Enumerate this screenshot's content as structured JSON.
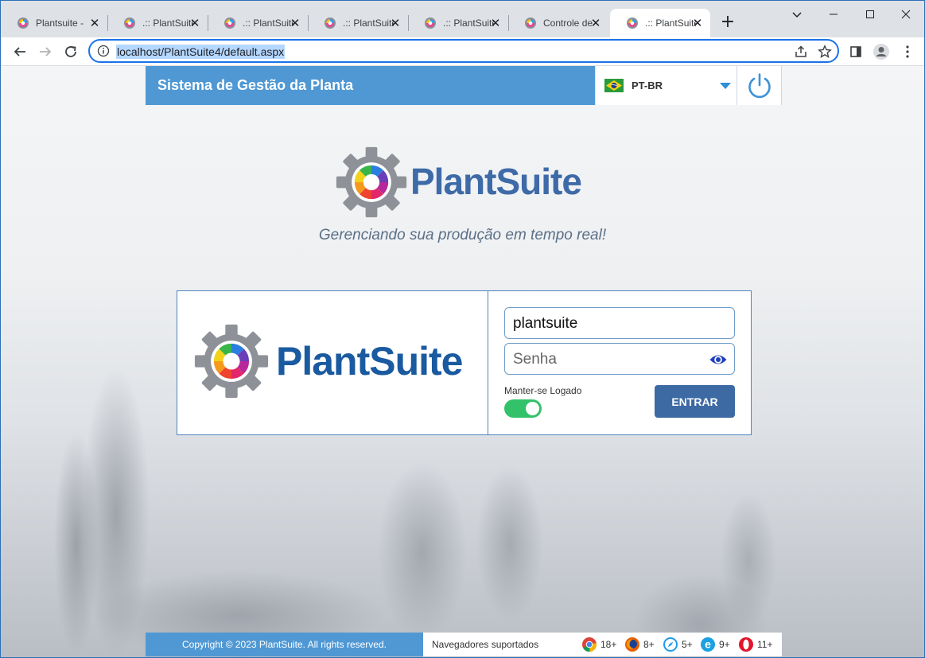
{
  "browser": {
    "tabs": [
      {
        "title": "Plantsuite - "
      },
      {
        "title": ".:: PlantSuite"
      },
      {
        "title": ".:: PlantSuite"
      },
      {
        "title": ".:: PlantSuite"
      },
      {
        "title": ".:: PlantSuite"
      },
      {
        "title": "Controle de "
      },
      {
        "title": ".:: PlantSuite"
      }
    ],
    "active_tab_index": 6,
    "url": "localhost/PlantSuite4/default.aspx"
  },
  "header": {
    "title": "Sistema de Gestão da Planta",
    "language": "PT-BR"
  },
  "hero": {
    "brand": "PlantSuite",
    "tagline": "Gerenciando sua produção em tempo real!"
  },
  "login": {
    "brand": "PlantSuite",
    "username_value": "plantsuite",
    "password_placeholder": "Senha",
    "keep_logged_label": "Manter-se Logado",
    "keep_logged_on": true,
    "submit_label": "ENTRAR"
  },
  "footer": {
    "copyright": "Copyright © 2023 PlantSuite. All rights reserved.",
    "browsers_label": "Navegadores suportados",
    "browsers": [
      {
        "name": "chrome-icon",
        "version": "18+"
      },
      {
        "name": "firefox-icon",
        "version": "8+"
      },
      {
        "name": "safari-icon",
        "version": "5+"
      },
      {
        "name": "ie-icon",
        "version": "9+"
      },
      {
        "name": "opera-icon",
        "version": "11+"
      }
    ]
  },
  "colors": {
    "header_blue": "#4f98d4",
    "brand_blue": "#1a5aa0",
    "button_blue": "#3d6aa3",
    "toggle_green": "#33c26a"
  }
}
